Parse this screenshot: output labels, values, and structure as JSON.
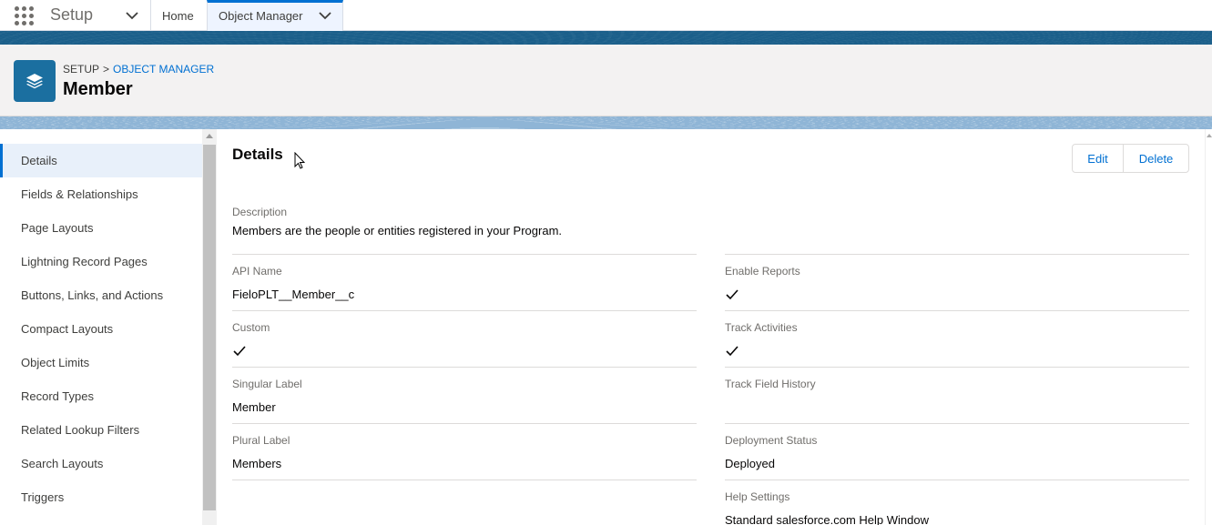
{
  "topnav": {
    "app_name": "Setup",
    "tabs": [
      {
        "label": "Home"
      },
      {
        "label": "Object Manager"
      }
    ]
  },
  "header": {
    "breadcrumb": {
      "root": "SETUP",
      "separator": ">",
      "current": "OBJECT MANAGER"
    },
    "title": "Member"
  },
  "sidebar": {
    "items": [
      {
        "label": "Details",
        "active": true
      },
      {
        "label": "Fields & Relationships"
      },
      {
        "label": "Page Layouts"
      },
      {
        "label": "Lightning Record Pages"
      },
      {
        "label": "Buttons, Links, and Actions"
      },
      {
        "label": "Compact Layouts"
      },
      {
        "label": "Object Limits"
      },
      {
        "label": "Record Types"
      },
      {
        "label": "Related Lookup Filters"
      },
      {
        "label": "Search Layouts"
      },
      {
        "label": "Triggers"
      }
    ]
  },
  "main": {
    "section_title": "Details",
    "buttons": {
      "edit": "Edit",
      "delete": "Delete"
    },
    "description": {
      "label": "Description",
      "value": "Members are the people or entities registered in your Program."
    },
    "left_fields": [
      {
        "label": "API Name",
        "value": "FieloPLT__Member__c"
      },
      {
        "label": "Custom",
        "checked": true
      },
      {
        "label": "Singular Label",
        "value": "Member"
      },
      {
        "label": "Plural Label",
        "value": "Members"
      }
    ],
    "right_fields": [
      {
        "label": "Enable Reports",
        "checked": true
      },
      {
        "label": "Track Activities",
        "checked": true
      },
      {
        "label": "Track Field History",
        "value": ""
      },
      {
        "label": "Deployment Status",
        "value": "Deployed"
      },
      {
        "label": "Help Settings",
        "value": "Standard salesforce.com Help Window"
      }
    ]
  },
  "colors": {
    "accent": "#0070d2",
    "brand_band": "#1b5f8a",
    "object_icon": "#1b6fa0"
  }
}
